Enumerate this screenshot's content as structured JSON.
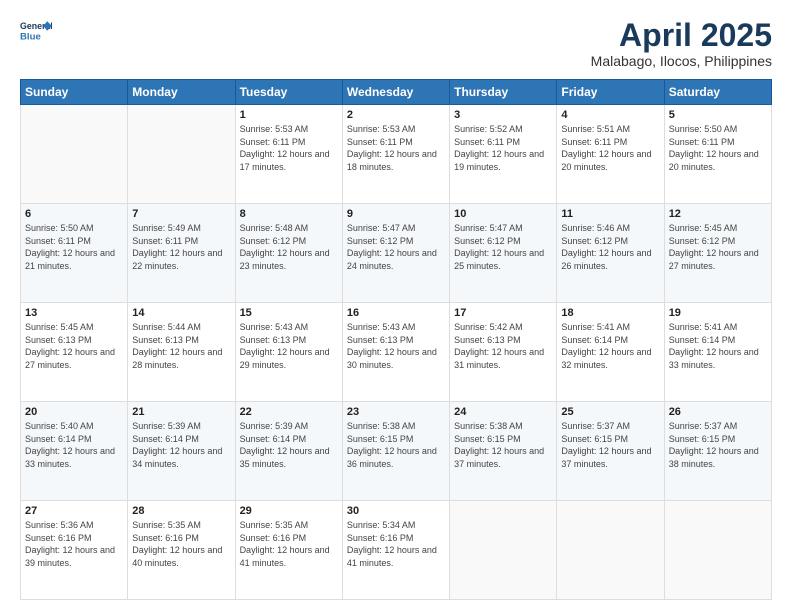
{
  "header": {
    "logo_line1": "General",
    "logo_line2": "Blue",
    "title": "April 2025",
    "subtitle": "Malabago, Ilocos, Philippines"
  },
  "weekdays": [
    "Sunday",
    "Monday",
    "Tuesday",
    "Wednesday",
    "Thursday",
    "Friday",
    "Saturday"
  ],
  "weeks": [
    [
      {
        "day": "",
        "sunrise": "",
        "sunset": "",
        "daylight": ""
      },
      {
        "day": "",
        "sunrise": "",
        "sunset": "",
        "daylight": ""
      },
      {
        "day": "1",
        "sunrise": "Sunrise: 5:53 AM",
        "sunset": "Sunset: 6:11 PM",
        "daylight": "Daylight: 12 hours and 17 minutes."
      },
      {
        "day": "2",
        "sunrise": "Sunrise: 5:53 AM",
        "sunset": "Sunset: 6:11 PM",
        "daylight": "Daylight: 12 hours and 18 minutes."
      },
      {
        "day": "3",
        "sunrise": "Sunrise: 5:52 AM",
        "sunset": "Sunset: 6:11 PM",
        "daylight": "Daylight: 12 hours and 19 minutes."
      },
      {
        "day": "4",
        "sunrise": "Sunrise: 5:51 AM",
        "sunset": "Sunset: 6:11 PM",
        "daylight": "Daylight: 12 hours and 20 minutes."
      },
      {
        "day": "5",
        "sunrise": "Sunrise: 5:50 AM",
        "sunset": "Sunset: 6:11 PM",
        "daylight": "Daylight: 12 hours and 20 minutes."
      }
    ],
    [
      {
        "day": "6",
        "sunrise": "Sunrise: 5:50 AM",
        "sunset": "Sunset: 6:11 PM",
        "daylight": "Daylight: 12 hours and 21 minutes."
      },
      {
        "day": "7",
        "sunrise": "Sunrise: 5:49 AM",
        "sunset": "Sunset: 6:11 PM",
        "daylight": "Daylight: 12 hours and 22 minutes."
      },
      {
        "day": "8",
        "sunrise": "Sunrise: 5:48 AM",
        "sunset": "Sunset: 6:12 PM",
        "daylight": "Daylight: 12 hours and 23 minutes."
      },
      {
        "day": "9",
        "sunrise": "Sunrise: 5:47 AM",
        "sunset": "Sunset: 6:12 PM",
        "daylight": "Daylight: 12 hours and 24 minutes."
      },
      {
        "day": "10",
        "sunrise": "Sunrise: 5:47 AM",
        "sunset": "Sunset: 6:12 PM",
        "daylight": "Daylight: 12 hours and 25 minutes."
      },
      {
        "day": "11",
        "sunrise": "Sunrise: 5:46 AM",
        "sunset": "Sunset: 6:12 PM",
        "daylight": "Daylight: 12 hours and 26 minutes."
      },
      {
        "day": "12",
        "sunrise": "Sunrise: 5:45 AM",
        "sunset": "Sunset: 6:12 PM",
        "daylight": "Daylight: 12 hours and 27 minutes."
      }
    ],
    [
      {
        "day": "13",
        "sunrise": "Sunrise: 5:45 AM",
        "sunset": "Sunset: 6:13 PM",
        "daylight": "Daylight: 12 hours and 27 minutes."
      },
      {
        "day": "14",
        "sunrise": "Sunrise: 5:44 AM",
        "sunset": "Sunset: 6:13 PM",
        "daylight": "Daylight: 12 hours and 28 minutes."
      },
      {
        "day": "15",
        "sunrise": "Sunrise: 5:43 AM",
        "sunset": "Sunset: 6:13 PM",
        "daylight": "Daylight: 12 hours and 29 minutes."
      },
      {
        "day": "16",
        "sunrise": "Sunrise: 5:43 AM",
        "sunset": "Sunset: 6:13 PM",
        "daylight": "Daylight: 12 hours and 30 minutes."
      },
      {
        "day": "17",
        "sunrise": "Sunrise: 5:42 AM",
        "sunset": "Sunset: 6:13 PM",
        "daylight": "Daylight: 12 hours and 31 minutes."
      },
      {
        "day": "18",
        "sunrise": "Sunrise: 5:41 AM",
        "sunset": "Sunset: 6:14 PM",
        "daylight": "Daylight: 12 hours and 32 minutes."
      },
      {
        "day": "19",
        "sunrise": "Sunrise: 5:41 AM",
        "sunset": "Sunset: 6:14 PM",
        "daylight": "Daylight: 12 hours and 33 minutes."
      }
    ],
    [
      {
        "day": "20",
        "sunrise": "Sunrise: 5:40 AM",
        "sunset": "Sunset: 6:14 PM",
        "daylight": "Daylight: 12 hours and 33 minutes."
      },
      {
        "day": "21",
        "sunrise": "Sunrise: 5:39 AM",
        "sunset": "Sunset: 6:14 PM",
        "daylight": "Daylight: 12 hours and 34 minutes."
      },
      {
        "day": "22",
        "sunrise": "Sunrise: 5:39 AM",
        "sunset": "Sunset: 6:14 PM",
        "daylight": "Daylight: 12 hours and 35 minutes."
      },
      {
        "day": "23",
        "sunrise": "Sunrise: 5:38 AM",
        "sunset": "Sunset: 6:15 PM",
        "daylight": "Daylight: 12 hours and 36 minutes."
      },
      {
        "day": "24",
        "sunrise": "Sunrise: 5:38 AM",
        "sunset": "Sunset: 6:15 PM",
        "daylight": "Daylight: 12 hours and 37 minutes."
      },
      {
        "day": "25",
        "sunrise": "Sunrise: 5:37 AM",
        "sunset": "Sunset: 6:15 PM",
        "daylight": "Daylight: 12 hours and 37 minutes."
      },
      {
        "day": "26",
        "sunrise": "Sunrise: 5:37 AM",
        "sunset": "Sunset: 6:15 PM",
        "daylight": "Daylight: 12 hours and 38 minutes."
      }
    ],
    [
      {
        "day": "27",
        "sunrise": "Sunrise: 5:36 AM",
        "sunset": "Sunset: 6:16 PM",
        "daylight": "Daylight: 12 hours and 39 minutes."
      },
      {
        "day": "28",
        "sunrise": "Sunrise: 5:35 AM",
        "sunset": "Sunset: 6:16 PM",
        "daylight": "Daylight: 12 hours and 40 minutes."
      },
      {
        "day": "29",
        "sunrise": "Sunrise: 5:35 AM",
        "sunset": "Sunset: 6:16 PM",
        "daylight": "Daylight: 12 hours and 41 minutes."
      },
      {
        "day": "30",
        "sunrise": "Sunrise: 5:34 AM",
        "sunset": "Sunset: 6:16 PM",
        "daylight": "Daylight: 12 hours and 41 minutes."
      },
      {
        "day": "",
        "sunrise": "",
        "sunset": "",
        "daylight": ""
      },
      {
        "day": "",
        "sunrise": "",
        "sunset": "",
        "daylight": ""
      },
      {
        "day": "",
        "sunrise": "",
        "sunset": "",
        "daylight": ""
      }
    ]
  ]
}
